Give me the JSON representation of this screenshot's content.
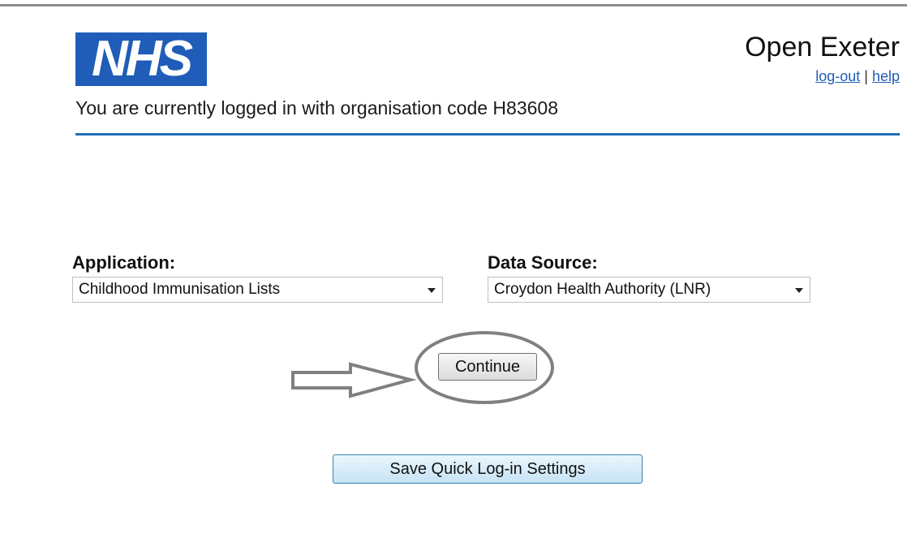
{
  "header": {
    "logo_text": "NHS",
    "app_title": "Open Exeter",
    "logout_link": "log-out",
    "separator": "|",
    "help_link": "help",
    "logged_in_text": "You are currently logged in with organisation code H83608"
  },
  "form": {
    "application": {
      "label": "Application:",
      "selected": "Childhood Immunisation Lists"
    },
    "data_source": {
      "label": "Data Source:",
      "selected": "Croydon Health Authority (LNR)"
    },
    "continue_label": "Continue",
    "save_label": "Save Quick Log-in Settings"
  },
  "colors": {
    "nhs_blue": "#1f5db8",
    "divider": "#1f6fb4",
    "annotation": "#808080"
  }
}
